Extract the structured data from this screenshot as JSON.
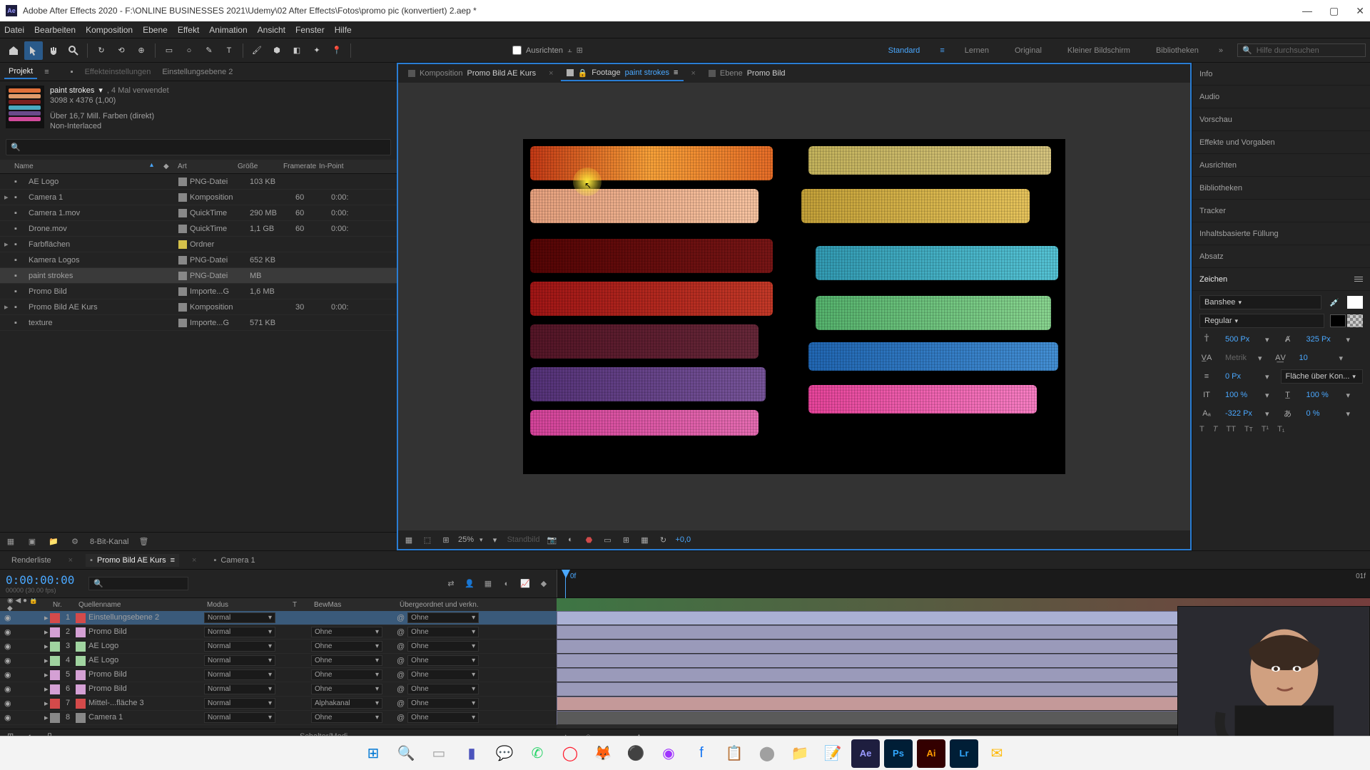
{
  "titlebar": {
    "title": "Adobe After Effects 2020 - F:\\ONLINE BUSINESSES 2021\\Udemy\\02 After Effects\\Fotos\\promo pic (konvertiert) 2.aep *"
  },
  "menu": [
    "Datei",
    "Bearbeiten",
    "Komposition",
    "Ebene",
    "Effekt",
    "Animation",
    "Ansicht",
    "Fenster",
    "Hilfe"
  ],
  "toolbar": {
    "align": "Ausrichten",
    "workspaces": [
      "Standard",
      "Lernen",
      "Original",
      "Kleiner Bildschirm",
      "Bibliotheken"
    ],
    "active_workspace": "Standard",
    "search_placeholder": "Hilfe durchsuchen"
  },
  "project_panel": {
    "tab1": "Projekt",
    "tab2": "Effekteinstellungen",
    "tab2_value": "Einstellungsebene 2",
    "asset": {
      "name": "paint strokes",
      "used": ", 4 Mal verwendet",
      "dims": "3098 x 4376 (1,00)",
      "colors": "Über 16,7 Mill. Farben (direkt)",
      "interlace": "Non-Interlaced"
    },
    "cols": {
      "name": "Name",
      "label": "",
      "type": "Art",
      "size": "Größe",
      "fps": "Framerate",
      "in": "In-Point"
    },
    "items": [
      {
        "arrow": "",
        "name": "AE Logo",
        "label": "#888",
        "type": "PNG-Datei",
        "size": "103 KB",
        "fps": "",
        "in": ""
      },
      {
        "arrow": "▸",
        "name": "Camera 1",
        "label": "#888",
        "type": "Komposition",
        "size": "",
        "fps": "60",
        "in": "0:00:"
      },
      {
        "arrow": "",
        "name": "Camera 1.mov",
        "label": "#888",
        "type": "QuickTime",
        "size": "290 MB",
        "fps": "60",
        "in": "0:00:"
      },
      {
        "arrow": "",
        "name": "Drone.mov",
        "label": "#888",
        "type": "QuickTime",
        "size": "1,1 GB",
        "fps": "60",
        "in": "0:00:"
      },
      {
        "arrow": "▸",
        "name": "Farbflächen",
        "label": "#d4c04a",
        "type": "Ordner",
        "size": "",
        "fps": "",
        "in": ""
      },
      {
        "arrow": "",
        "name": "Kamera Logos",
        "label": "#888",
        "type": "PNG-Datei",
        "size": "652 KB",
        "fps": "",
        "in": ""
      },
      {
        "arrow": "",
        "name": "paint strokes",
        "label": "#888",
        "type": "PNG-Datei",
        "size": "    MB",
        "fps": "",
        "in": "",
        "selected": true
      },
      {
        "arrow": "",
        "name": "Promo Bild",
        "label": "#888",
        "type": "Importe...G",
        "size": "1,6 MB",
        "fps": "",
        "in": ""
      },
      {
        "arrow": "▸",
        "name": "Promo Bild AE Kurs",
        "label": "#888",
        "type": "Komposition",
        "size": "",
        "fps": "30",
        "in": "0:00:"
      },
      {
        "arrow": "",
        "name": "texture",
        "label": "#888",
        "type": "Importe...G",
        "size": "571 KB",
        "fps": "",
        "in": ""
      }
    ],
    "footer_depth": "8-Bit-Kanal"
  },
  "viewer": {
    "tabs": [
      {
        "label": "Komposition",
        "value": "Promo Bild AE Kurs",
        "active": false
      },
      {
        "label": "Footage",
        "value": "paint strokes",
        "active": true
      },
      {
        "label": "Ebene",
        "value": "Promo Bild",
        "active": false
      }
    ],
    "zoom": "25%",
    "standbild": "Standbild",
    "exposure": "+0,0"
  },
  "right_panel": {
    "items": [
      "Info",
      "Audio",
      "Vorschau",
      "Effekte und Vorgaben",
      "Ausrichten",
      "Bibliotheken",
      "Tracker",
      "Inhaltsbasierte Füllung",
      "Absatz"
    ],
    "zeichen": "Zeichen",
    "char": {
      "font": "Banshee",
      "style": "Regular",
      "size": "500 Px",
      "leading": "325 Px",
      "kerning": "Metrik",
      "tracking": "10",
      "stroke": "0 Px",
      "stroke_type": "Fläche über Kon...",
      "vscale": "100 %",
      "hscale": "100 %",
      "baseline": "-322 Px",
      "tsume": "0 %"
    }
  },
  "timeline": {
    "tabs": [
      "Renderliste",
      "Promo Bild AE Kurs",
      "Camera 1"
    ],
    "active_tab": "Promo Bild AE Kurs",
    "timecode": "0:00:00:00",
    "frame_info": "00000 (30.00 fps)",
    "time_right": "01f",
    "playhead_label": "0f",
    "cols": {
      "nr": "Nr.",
      "name": "Quellenname",
      "mode": "Modus",
      "t": "T",
      "bewmas": "BewMas",
      "parent": "Übergeordnet und verkn."
    },
    "layers": [
      {
        "nr": "1",
        "name": "Einstellungsebene 2",
        "label": "#d44a4a",
        "mode": "Normal",
        "bewmas": "",
        "parent": "Ohne",
        "sel": true
      },
      {
        "nr": "2",
        "name": "Promo Bild",
        "label": "#d4a0d4",
        "mode": "Normal",
        "bewmas": "Ohne",
        "parent": "Ohne"
      },
      {
        "nr": "3",
        "name": "AE Logo",
        "label": "#a0d4a0",
        "mode": "Normal",
        "bewmas": "Ohne",
        "parent": "Ohne"
      },
      {
        "nr": "4",
        "name": "AE Logo",
        "label": "#a0d4a0",
        "mode": "Normal",
        "bewmas": "Ohne",
        "parent": "Ohne"
      },
      {
        "nr": "5",
        "name": "Promo Bild",
        "label": "#d4a0d4",
        "mode": "Normal",
        "bewmas": "Ohne",
        "parent": "Ohne"
      },
      {
        "nr": "6",
        "name": "Promo Bild",
        "label": "#d4a0d4",
        "mode": "Normal",
        "bewmas": "Ohne",
        "parent": "Ohne"
      },
      {
        "nr": "7",
        "name": "Mittel-...fläche 3",
        "label": "#d44a4a",
        "mode": "Normal",
        "bewmas": "Alphakanal",
        "parent": "Ohne",
        "red": true
      },
      {
        "nr": "8",
        "name": "Camera 1",
        "label": "#888",
        "mode": "Normal",
        "bewmas": "Ohne",
        "parent": "Ohne",
        "cam": true
      }
    ],
    "footer": "Schalter/Modi"
  },
  "taskbar": {
    "icons": [
      "windows",
      "search",
      "taskview",
      "teams",
      "chat",
      "whatsapp",
      "opera",
      "firefox",
      "app1",
      "messenger",
      "facebook",
      "notes",
      "obs",
      "files",
      "editor",
      "ae",
      "ps",
      "ai",
      "lr",
      "mail"
    ]
  }
}
